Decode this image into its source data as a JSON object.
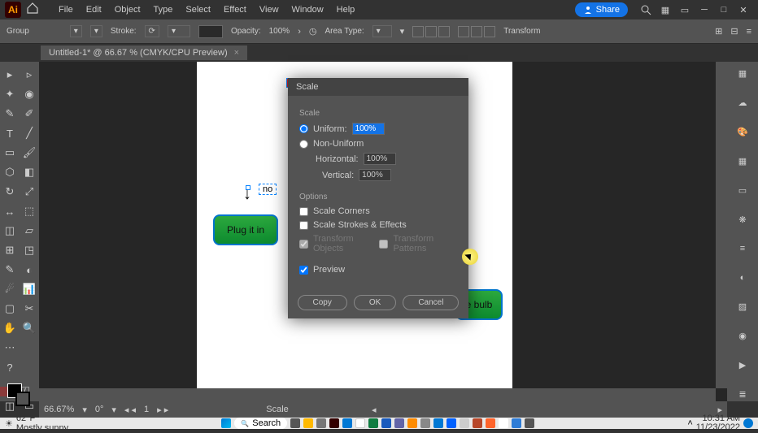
{
  "app": {
    "name": "Ai"
  },
  "menu": {
    "items": [
      "File",
      "Edit",
      "Object",
      "Type",
      "Select",
      "Effect",
      "View",
      "Window",
      "Help"
    ]
  },
  "header": {
    "share": "Share"
  },
  "controlbar": {
    "mode": "Group",
    "stroke_label": "Stroke:",
    "opacity_label": "Opacity:",
    "opacity_value": "100%",
    "area_label": "Area Type:",
    "transform": "Transform"
  },
  "tab": {
    "title": "Untitled-1* @ 66.67 % (CMYK/CPU Preview)",
    "close": "×"
  },
  "canvas": {
    "green1": "Plug it in",
    "green2": "e bulb",
    "textfrag": "no"
  },
  "dialog": {
    "title": "Scale",
    "section_scale": "Scale",
    "uniform": "Uniform:",
    "uniform_val": "100%",
    "nonuniform": "Non-Uniform",
    "horizontal": "Horizontal:",
    "horizontal_val": "100%",
    "vertical": "Vertical:",
    "vertical_val": "100%",
    "section_options": "Options",
    "scale_corners": "Scale Corners",
    "scale_strokes": "Scale Strokes & Effects",
    "transform_objects": "Transform Objects",
    "transform_patterns": "Transform Patterns",
    "preview": "Preview",
    "copy": "Copy",
    "ok": "OK",
    "cancel": "Cancel"
  },
  "status": {
    "zoom": "66.67%",
    "rotate": "0°",
    "page": "1",
    "tool": "Scale"
  },
  "taskbar": {
    "temp": "62°F",
    "cond": "Mostly sunny",
    "search": "Search",
    "time": "10:31 AM",
    "date": "11/23/2022"
  }
}
